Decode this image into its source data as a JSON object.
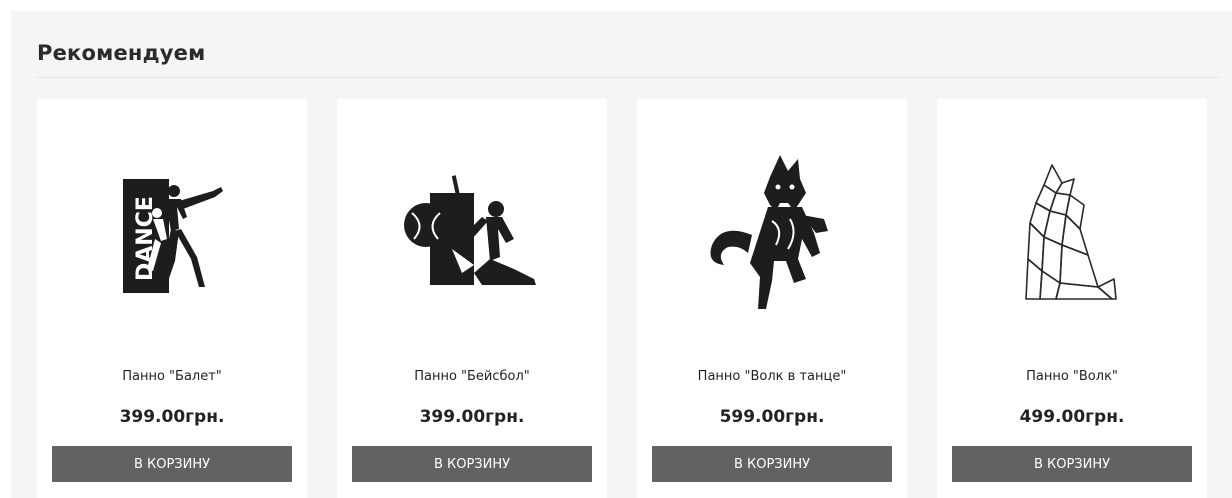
{
  "section": {
    "title": "Рекомендуем"
  },
  "products": [
    {
      "name": "Панно \"Балет\"",
      "price": "399.00грн.",
      "button": "В КОРЗИНУ",
      "image_text": "DANCE",
      "image": "ballet-dance-panel-image"
    },
    {
      "name": "Панно \"Бейсбол\"",
      "price": "399.00грн.",
      "button": "В КОРЗИНУ",
      "image": "baseball-panel-image"
    },
    {
      "name": "Панно \"Волк в танце\"",
      "price": "599.00грн.",
      "button": "В КОРЗИНУ",
      "image": "dancing-wolf-panel-image"
    },
    {
      "name": "Панно \"Волк\"",
      "price": "499.00грн.",
      "button": "В КОРЗИНУ",
      "image": "geometric-wolf-panel-image"
    }
  ],
  "colors": {
    "background": "#f6f5f3",
    "card": "#ffffff",
    "button": "#626262",
    "text": "#222222"
  }
}
